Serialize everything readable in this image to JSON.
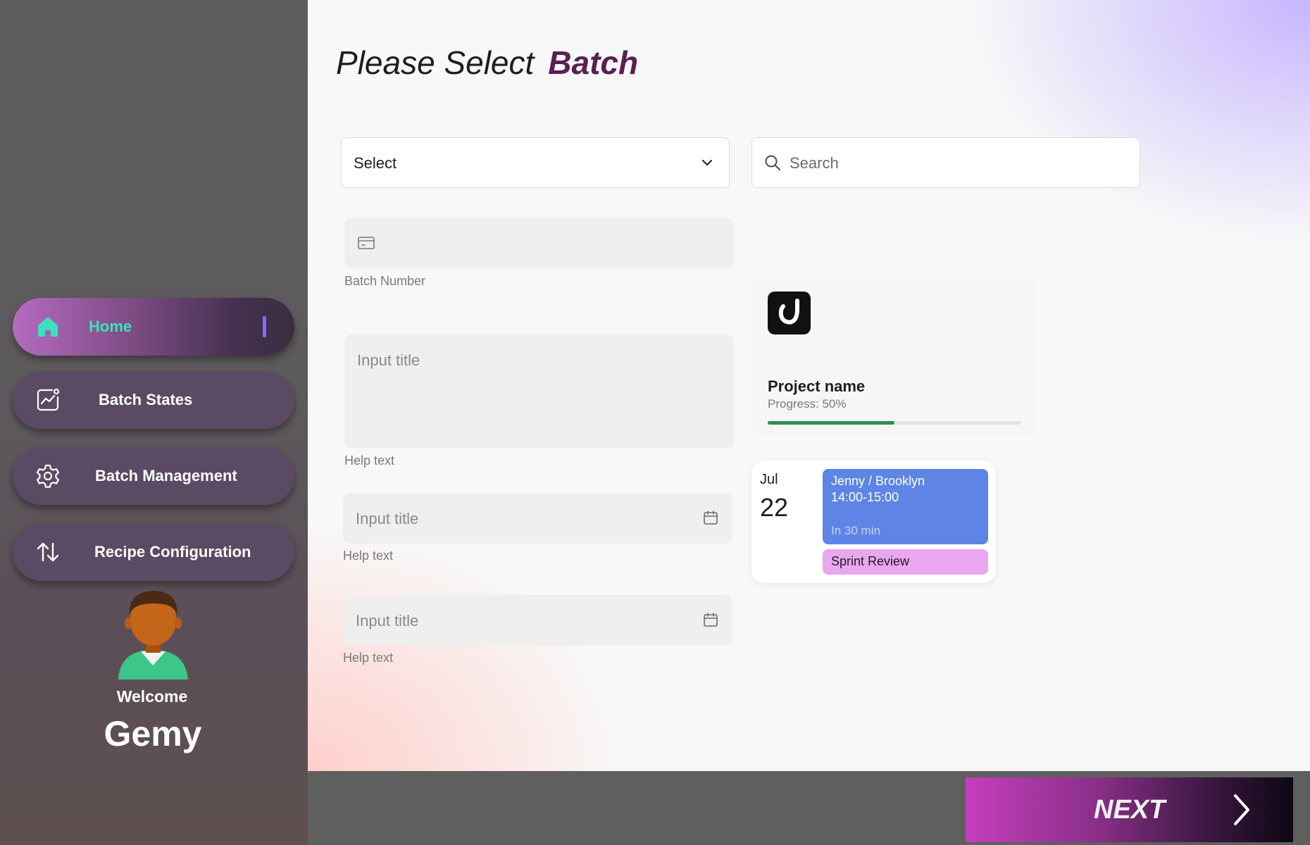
{
  "sidebar": {
    "items": [
      {
        "label": "Home",
        "icon": "home-icon",
        "active": true
      },
      {
        "label": "Batch States",
        "icon": "chart-icon"
      },
      {
        "label": "Batch Management",
        "icon": "gear-icon"
      },
      {
        "label": "Recipe Configuration",
        "icon": "sort-arrows-icon"
      }
    ],
    "welcome": "Welcome",
    "user_name": "Gemy"
  },
  "main": {
    "title_prefix": "Please Select",
    "title_accent": "Batch",
    "select": {
      "value": "Select"
    },
    "search": {
      "placeholder": "Search"
    },
    "batch_number": {
      "label": "Batch Number"
    },
    "text_field": {
      "placeholder": "Input title",
      "help": "Help text"
    },
    "date_field_1": {
      "placeholder": "Input title",
      "help": "Help text"
    },
    "date_field_2": {
      "placeholder": "Input title",
      "help": "Help text"
    },
    "project": {
      "name": "Project name",
      "progress_label": "Progress: 50%",
      "progress": 0.5
    },
    "calendar": {
      "month": "Jul",
      "day": "22",
      "event": {
        "title": "Jenny / Brooklyn",
        "time": "14:00-15:00",
        "relative": "In 30 min"
      },
      "sprint": "Sprint Review"
    }
  },
  "footer": {
    "next_label": "NEXT"
  },
  "colors": {
    "accent_title": "#5b1f55",
    "home_text": "#3fe0c0",
    "event_blue": "#5e84e6",
    "event_pink": "#eaa6ef",
    "progress_green": "#2e8b57"
  }
}
